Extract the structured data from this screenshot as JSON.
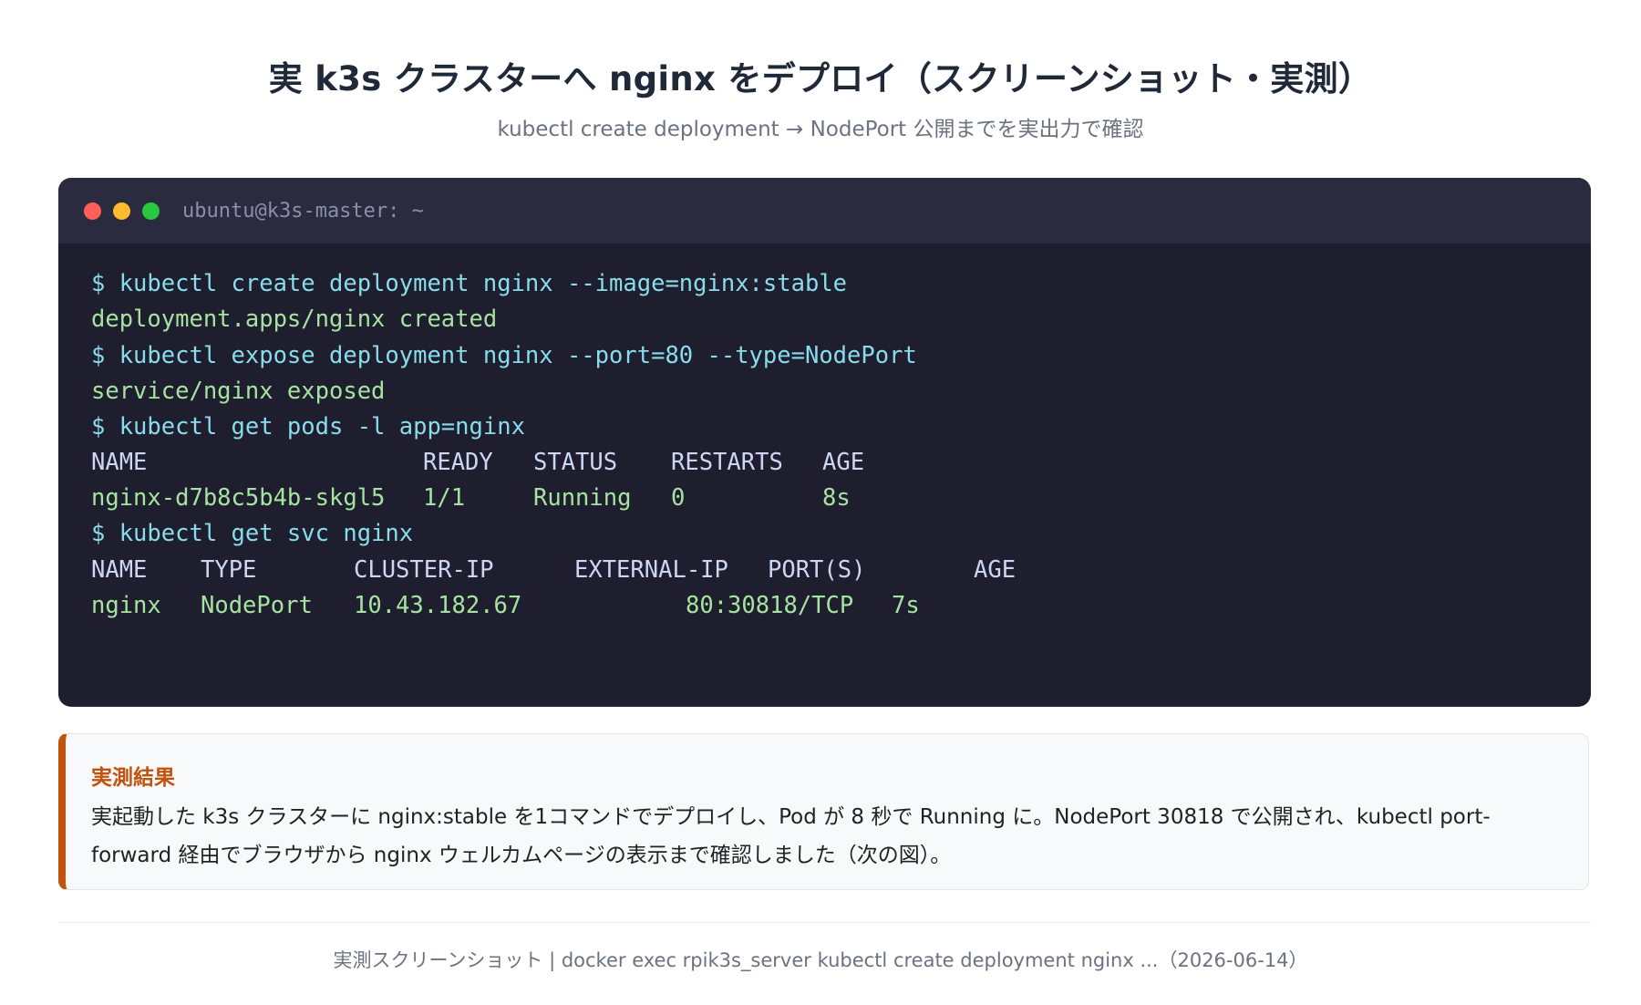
{
  "page": {
    "title": "実 k3s クラスターへ nginx をデプロイ（スクリーンショット・実測）",
    "subtitle": "kubectl create deployment → NodePort 公開までを実出力で確認"
  },
  "terminal": {
    "window_title": "ubuntu@k3s-master: ~",
    "lines": [
      "$ kubectl create deployment nginx --image=nginx:stable",
      "deployment.apps/nginx created",
      "$ kubectl expose deployment nginx --port=80 --type=NodePort",
      "service/nginx exposed",
      "$ kubectl get pods -l app=nginx",
      "$ kubectl get svc nginx"
    ],
    "pods_table": {
      "headers": [
        "NAME",
        "READY",
        "STATUS",
        "RESTARTS",
        "AGE"
      ],
      "row": [
        "nginx-d7b8c5b4b-skgl5",
        "1/1",
        "Running",
        "0",
        "8s"
      ]
    },
    "svc_table": {
      "headers": [
        "NAME",
        "TYPE",
        "CLUSTER-IP",
        "EXTERNAL-IP",
        "PORT(S)",
        "AGE"
      ],
      "row": [
        "nginx",
        "NodePort",
        "10.43.182.67",
        "80:30818/TCP",
        "7s"
      ]
    }
  },
  "callout": {
    "title": "実測結果",
    "text": "実起動した k3s クラスターに nginx:stable を1コマンドでデプロイし、Pod が 8 秒で Running に。NodePort 30818 で公開され、kubectl port-forward 経由でブラウザから nginx ウェルカムページの表示まで確認しました（次の図）。"
  },
  "footer": {
    "text": "実測スクリーンショット | docker exec rpik3s_server kubectl create deployment nginx ...（2026-06-14）"
  },
  "colors": {
    "terminal_bg": "#1e1e2e",
    "titlebar_bg": "#2b2b3f",
    "command": "#89dceb",
    "output": "#a6e3a1",
    "header": "#cdd6f4",
    "accent": "#c2530e"
  }
}
